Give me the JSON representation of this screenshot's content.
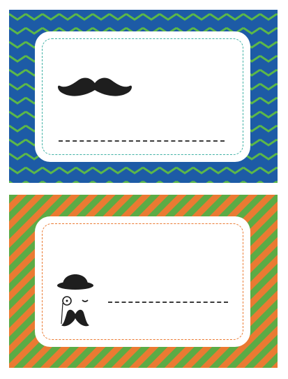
{
  "labels": [
    {
      "name": "mustache-label",
      "pattern": "chevron",
      "colors": {
        "background": "#1d5ba6",
        "accent": "#5cb848",
        "frame": "#3fb1a4"
      },
      "icon": "mustache-icon"
    },
    {
      "name": "gentleman-label",
      "pattern": "diagonal-stripes",
      "colors": {
        "background": "#ea7a32",
        "accent": "#5cab45",
        "frame": "#ea7a32"
      },
      "icon": "bowler-hat-monocle-mustache-icon"
    }
  ]
}
